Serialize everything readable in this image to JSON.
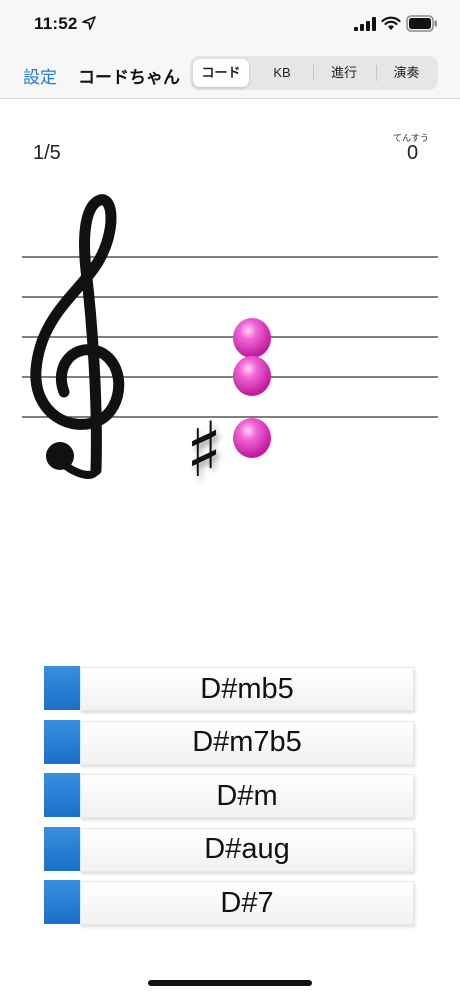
{
  "status_bar": {
    "time": "11:52"
  },
  "nav": {
    "settings_label": "設定",
    "title": "コードちゃん",
    "tabs": [
      {
        "label": "コード",
        "selected": true
      },
      {
        "label": "KB",
        "selected": false
      },
      {
        "label": "進行",
        "selected": false
      },
      {
        "label": "演奏",
        "selected": false
      }
    ]
  },
  "quiz": {
    "progress": "1/5",
    "score_caption": "てんすう",
    "score": "0",
    "accidental": "♯"
  },
  "choices": [
    {
      "label": "D#mb5"
    },
    {
      "label": "D#m7b5"
    },
    {
      "label": "D#m"
    },
    {
      "label": "D#aug"
    },
    {
      "label": "D#7"
    }
  ],
  "colors": {
    "accent": "#1e7ad7",
    "note": "#e83fc8",
    "swatch": "#2a7fd4"
  }
}
